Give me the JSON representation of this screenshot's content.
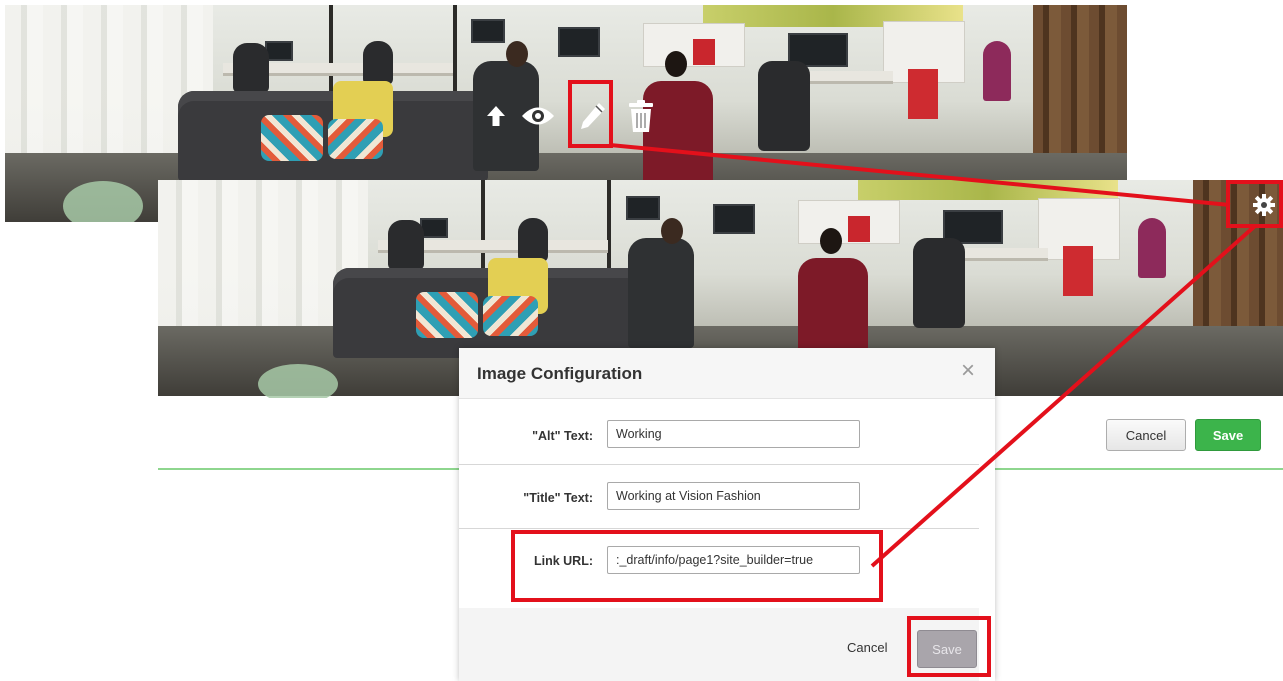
{
  "toolbar": {
    "icons": [
      "upload-icon",
      "eye-icon",
      "pencil-icon",
      "trash-icon"
    ]
  },
  "editor": {
    "cancel_label": "Cancel",
    "save_label": "Save"
  },
  "modal": {
    "title": "Image Configuration",
    "close_symbol": "×",
    "fields": {
      "alt_label": "\"Alt\" Text:",
      "alt_value": "Working",
      "title_label": "\"Title\" Text:",
      "title_value": "Working at Vision Fashion",
      "link_label": "Link URL:",
      "link_value": ":_draft/info/page1?site_builder=true"
    },
    "cancel_label": "Cancel",
    "save_label": "Save"
  },
  "colors": {
    "callout_red": "#e3101b",
    "save_green": "#3cb44b",
    "panel_border_green": "#8ed68e"
  }
}
